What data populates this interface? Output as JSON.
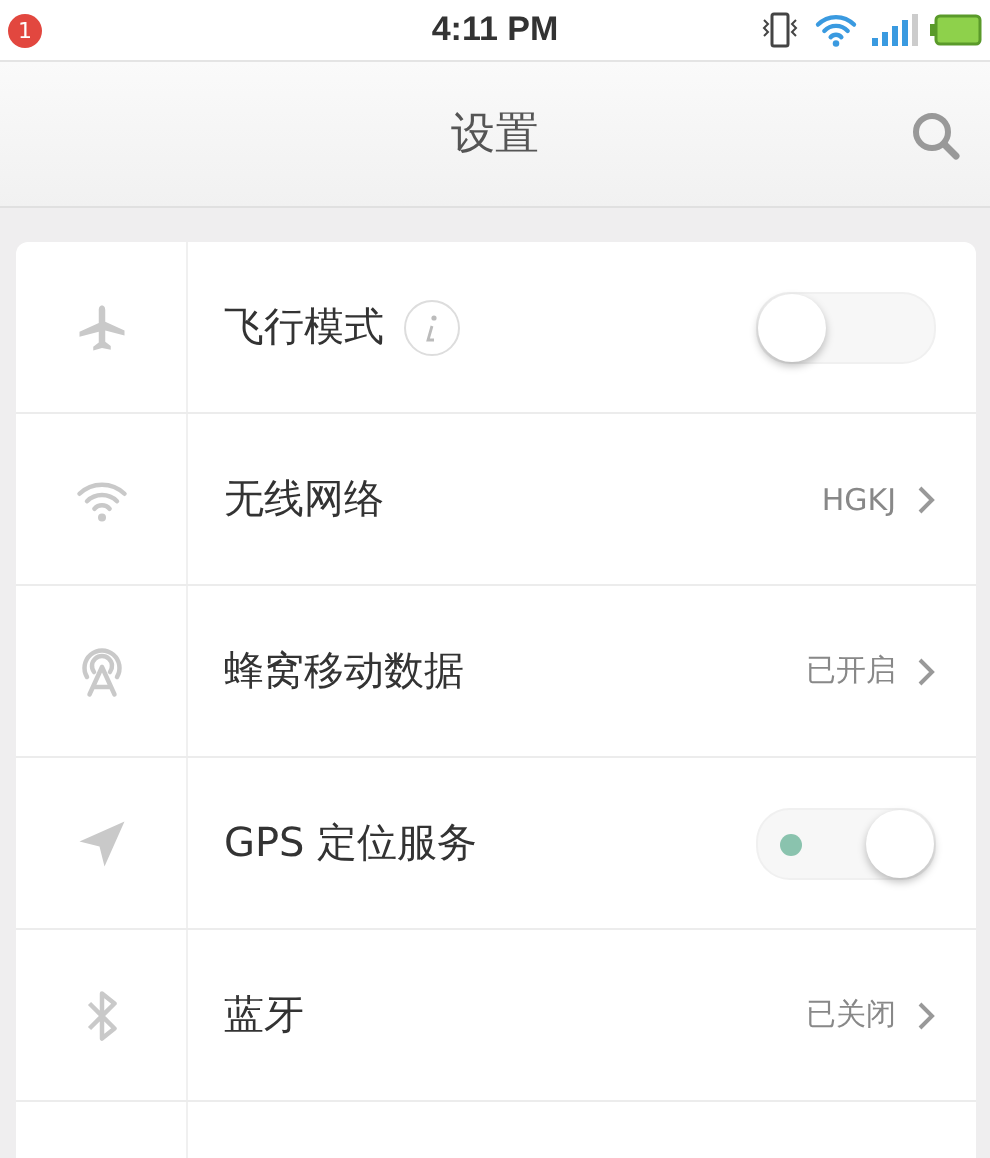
{
  "status_bar": {
    "badge": "1",
    "time": "4:11 PM"
  },
  "nav_bar": {
    "title": "设置"
  },
  "settings": [
    {
      "kind": "toggle",
      "label": "飞行模式",
      "info": true,
      "on": false
    },
    {
      "kind": "link",
      "label": "无线网络",
      "value": "HGKJ"
    },
    {
      "kind": "link",
      "label": "蜂窝移动数据",
      "value": "已开启"
    },
    {
      "kind": "toggle",
      "label": "GPS 定位服务",
      "info": false,
      "on": true
    },
    {
      "kind": "link",
      "label": "蓝牙",
      "value": "已关闭"
    }
  ]
}
